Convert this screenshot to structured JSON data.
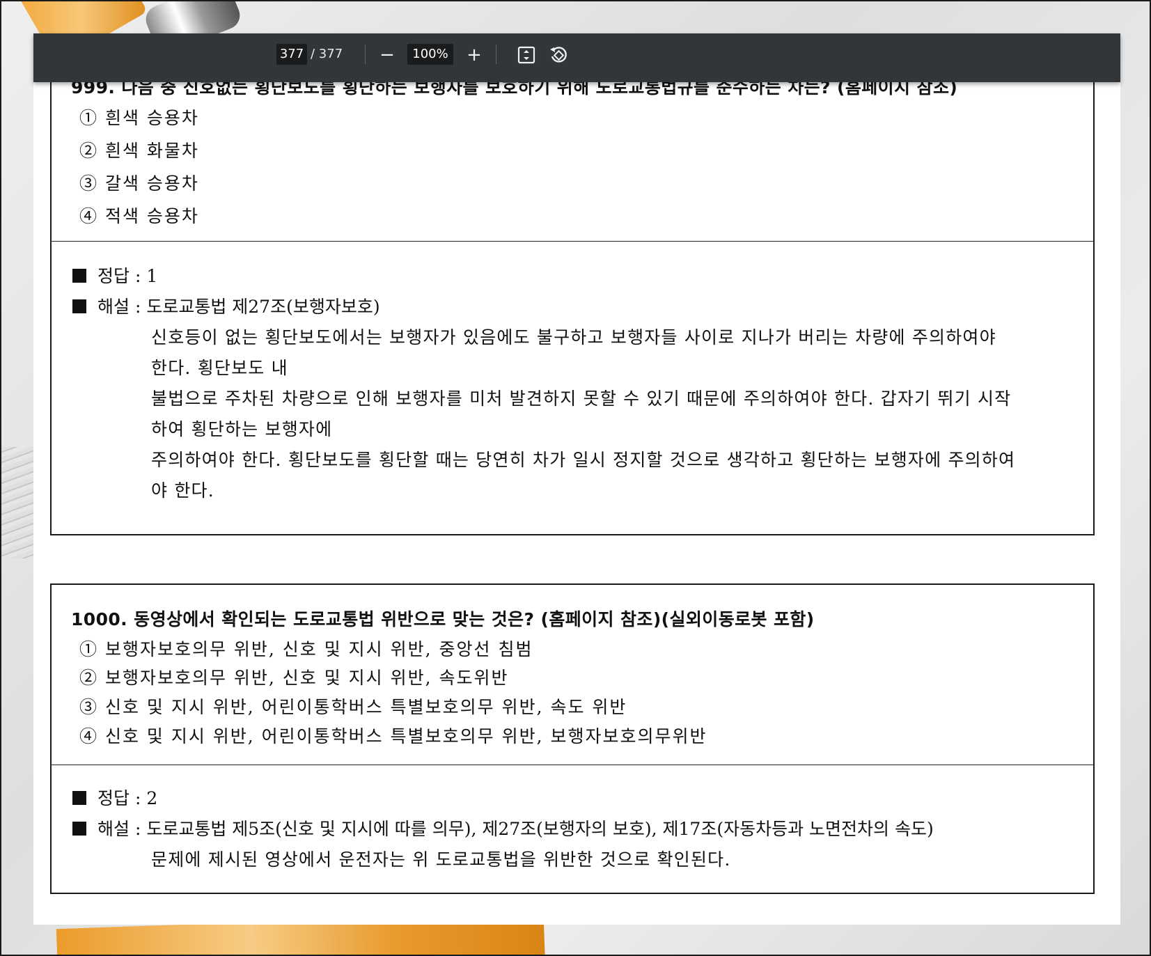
{
  "viewer": {
    "current_page": "377",
    "page_separator": "/ 377",
    "zoom": "100%",
    "zoom_out_symbol": "−",
    "zoom_in_symbol": "+"
  },
  "questions": [
    {
      "title": "999. 다음 중 신호없는 횡단보도를 횡단하는 보행자를 보호하기 위해 도로교통법규를 준수하는 차는? (홈페이지 참조)",
      "options": [
        "① 흰색 승용차",
        "② 흰색 화물차",
        "③ 갈색 승용차",
        "④ 적색 승용차"
      ],
      "answer_label": "정답 : 1",
      "explanation_label": "해설 : 도로교통법 제27조(보행자보호)",
      "explanation": [
        "신호등이 없는 횡단보도에서는 보행자가 있음에도 불구하고 보행자들 사이로 지나가 버리는 차량에 주의하여야",
        "한다. 횡단보도 내",
        "불법으로 주차된 차량으로 인해 보행자를 미처 발견하지 못할 수 있기 때문에 주의하여야 한다. 갑자기 뛰기 시작",
        "하여 횡단하는 보행자에",
        "주의하여야 한다. 횡단보도를 횡단할 때는 당연히 차가 일시 정지할 것으로 생각하고 횡단하는 보행자에 주의하여",
        "야 한다."
      ]
    },
    {
      "title": "1000. 동영상에서 확인되는 도로교통법 위반으로 맞는 것은? (홈페이지 참조)(실외이동로봇 포함)",
      "options": [
        "① 보행자보호의무 위반, 신호 및 지시 위반, 중앙선 침범",
        "② 보행자보호의무 위반, 신호 및 지시 위반, 속도위반",
        "③ 신호 및 지시 위반, 어린이통학버스 특별보호의무 위반, 속도 위반",
        "④ 신호 및 지시 위반, 어린이통학버스 특별보호의무 위반, 보행자보호의무위반"
      ],
      "answer_label": "정답 : 2",
      "explanation_label": "해설 : 도로교통법 제5조(신호 및 지시에 따를 의무), 제27조(보행자의 보호), 제17조(자동차등과 노면전차의 속도)",
      "explanation": [
        "문제에 제시된 영상에서 운전자는 위 도로교통법을 위반한 것으로 확인된다."
      ]
    }
  ]
}
